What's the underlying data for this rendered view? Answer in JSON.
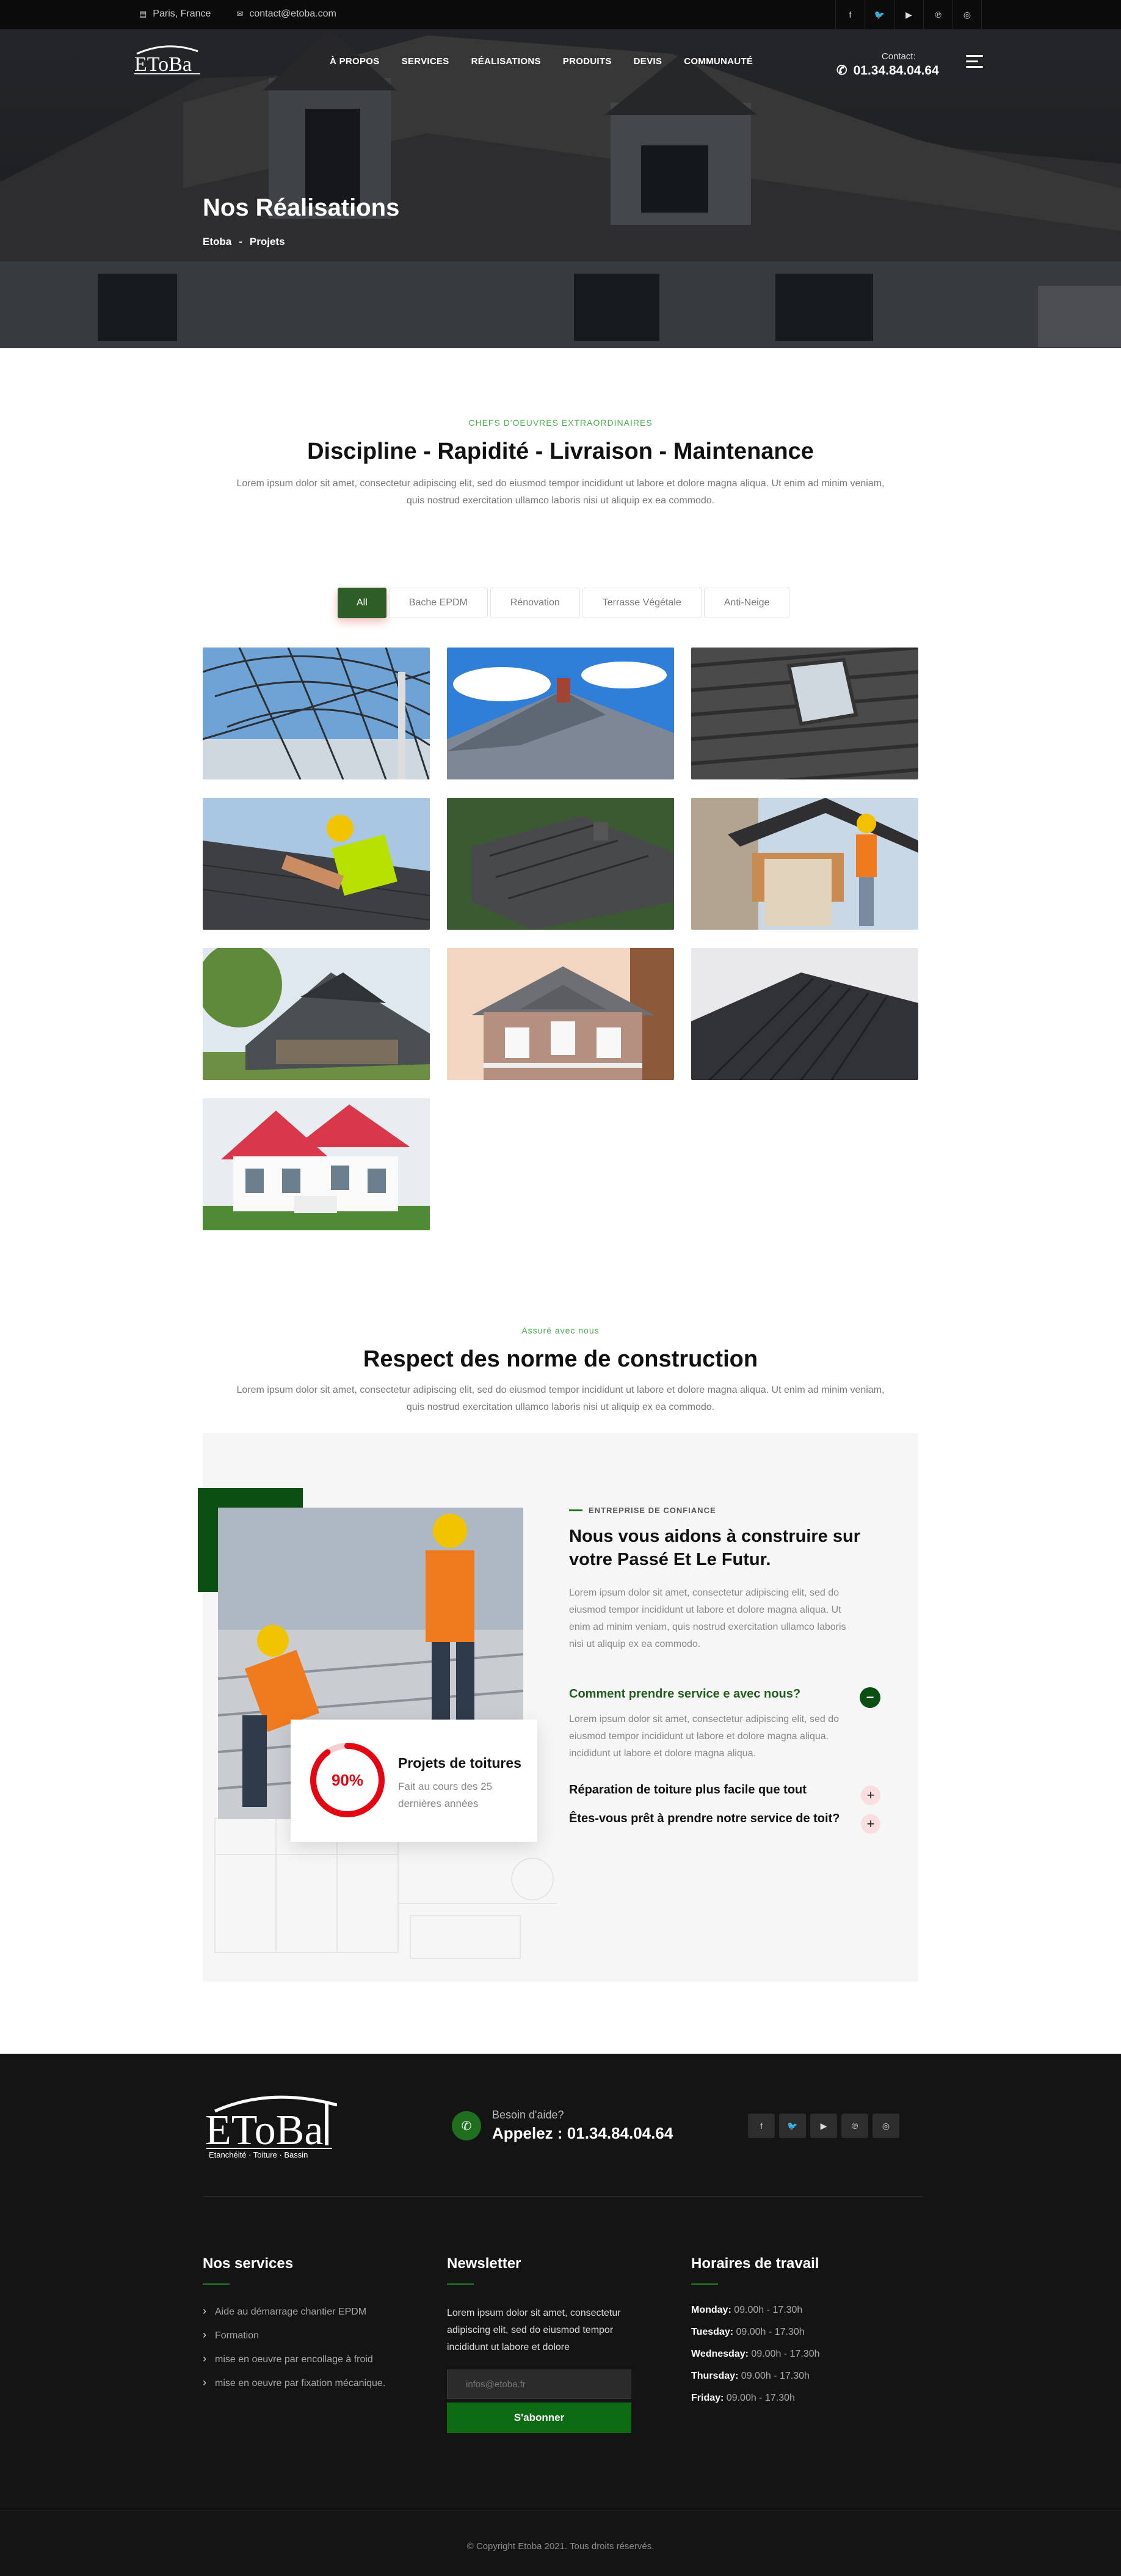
{
  "topbar": {
    "location": "Paris, France",
    "email": "contact@etoba.com",
    "social_icons": [
      "facebook-icon",
      "twitter-icon",
      "youtube-icon",
      "pinterest-icon",
      "instagram-icon"
    ]
  },
  "brand": {
    "name": "EToBa",
    "tagline": "Etanchéité · Toiture · Bassin"
  },
  "nav": [
    "À PROPOS",
    "SERVICES",
    "RÉALISATIONS",
    "PRODUITS",
    "DEVIS",
    "COMMUNAUTÉ"
  ],
  "contact": {
    "label": "Contact:",
    "phone": "01.34.84.04.64"
  },
  "hero": {
    "title": "Nos Réalisations",
    "breadcrumb": [
      "Etoba",
      "-",
      "Projets"
    ]
  },
  "intro": {
    "eyebrow": "CHEFS D'OEUVRES EXTRAORDINAIRES",
    "title": "Discipline - Rapidité - Livraison - Maintenance",
    "text": "Lorem ipsum dolor sit amet, consectetur adipiscing elit, sed do eiusmod tempor incididunt ut labore et dolore magna aliqua. Ut enim ad minim veniam, quis nostrud exercitation ullamco laboris nisi ut aliquip ex ea commodo."
  },
  "filters": [
    "All",
    "Bache EPDM",
    "Rénovation",
    "Terrasse Végétale",
    "Anti-Neige"
  ],
  "standards": {
    "eyebrow": "Assuré avec nous",
    "title": "Respect des norme de construction",
    "text": "Lorem ipsum dolor sit amet, consectetur adipiscing elit, sed do eiusmod tempor incididunt ut labore et dolore magna aliqua. Ut enim ad minim veniam, quis nostrud exercitation ullamco laboris nisi ut aliquip ex ea commodo."
  },
  "trust": {
    "eyebrow": "ENTREPRISE DE CONFIANCE",
    "title_line1": "Nous vous aidons à construire sur",
    "title_line2": "votre Passé Et Le Futur.",
    "text": "Lorem ipsum dolor sit amet, consectetur adipiscing elit, sed do eiusmod tempor incididunt ut labore et dolore magna aliqua. Ut enim ad minim veniam, quis nostrud exercitation ullamco laboris nisi ut aliquip ex ea commodo.",
    "faq": [
      {
        "q": "Comment prendre service e avec nous?",
        "a": "Lorem ipsum dolor sit amet, consectetur adipiscing elit, sed do eiusmod tempor incididunt ut labore et dolore magna aliqua. incididunt ut labore et dolore magna aliqua.",
        "open": true
      },
      {
        "q": "Réparation de toiture plus facile que tout",
        "open": false
      },
      {
        "q": "Êtes-vous prêt à prendre notre service de toit?",
        "open": false
      }
    ],
    "stat": {
      "percent": "90%",
      "value": 0.9,
      "title": "Projets de toitures",
      "sub": "Fait au cours des 25 dernières années"
    }
  },
  "footer": {
    "help_label": "Besoin d'aide?",
    "help_phone": "Appelez : 01.34.84.04.64",
    "services_title": "Nos services",
    "services": [
      "Aide au démarrage chantier EPDM",
      "Formation",
      "mise en oeuvre par encollage à froid",
      "mise en oeuvre par fixation mécanique."
    ],
    "newsletter_title": "Newsletter",
    "newsletter_text": "Lorem ipsum dolor sit amet, consectetur adipiscing elit, sed do eiusmod tempor incididunt ut labore et dolore",
    "newsletter_placeholder": "infos@etoba.fr",
    "newsletter_button": "S'abonner",
    "hours_title": "Horaires de travail",
    "hours": [
      {
        "day": "Monday:",
        "time": "09.00h - 17.30h"
      },
      {
        "day": "Tuesday:",
        "time": "09.00h - 17.30h"
      },
      {
        "day": "Wednesday:",
        "time": "09.00h - 17.30h"
      },
      {
        "day": "Thursday:",
        "time": "09.00h - 17.30h"
      },
      {
        "day": "Friday:",
        "time": "09.00h - 17.30h"
      }
    ],
    "copyright": "© Copyright Etoba 2021. Tous droits réservés."
  },
  "colors": {
    "accent_green": "#2f5d27",
    "dark_green": "#1f6f1f",
    "eyebrow_green": "#4caf50",
    "red": "#e30613"
  }
}
